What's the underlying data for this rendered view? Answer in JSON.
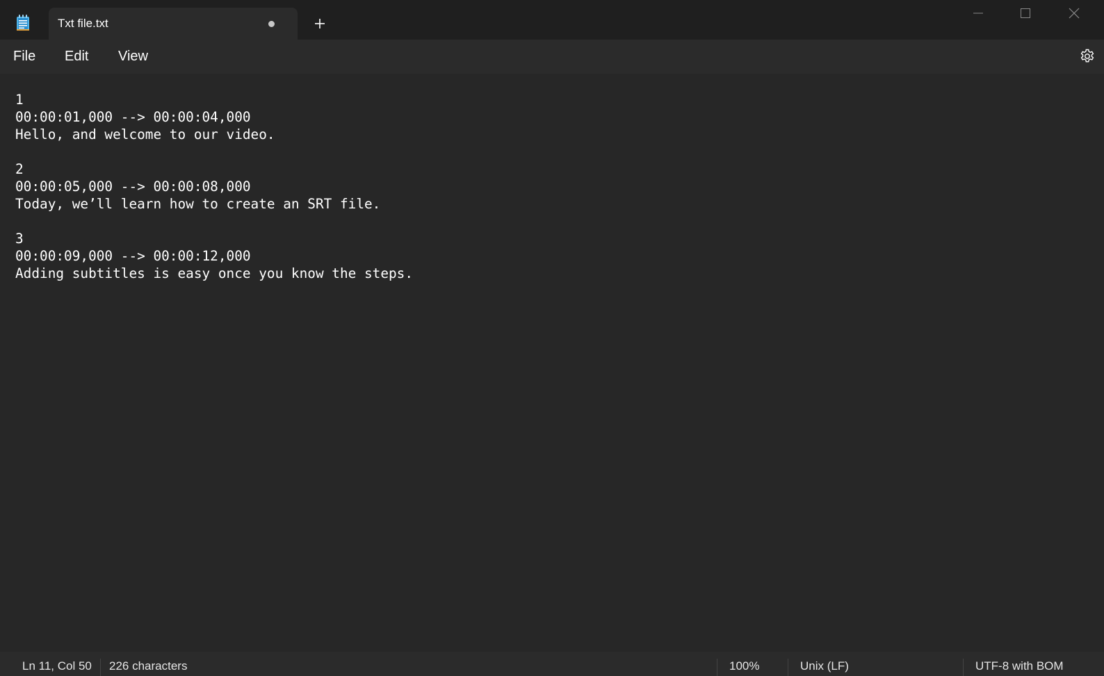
{
  "app": {
    "icon": "notepad-icon"
  },
  "tab": {
    "title": "Txt file.txt",
    "unsaved_indicator": "unsaved-dot-icon"
  },
  "titlebar": {
    "new_tab_icon": "plus-icon",
    "minimize_icon": "minimize-icon",
    "maximize_icon": "maximize-icon",
    "close_icon": "close-icon"
  },
  "menu": {
    "file": "File",
    "edit": "Edit",
    "view": "View",
    "settings_icon": "gear-icon"
  },
  "editor": {
    "content": "1\n00:00:01,000 --> 00:00:04,000\nHello, and welcome to our video.\n\n2\n00:00:05,000 --> 00:00:08,000\nToday, we’ll learn how to create an SRT file.\n\n3\n00:00:09,000 --> 00:00:12,000\nAdding subtitles is easy once you know the steps."
  },
  "status": {
    "position": "Ln 11, Col 50",
    "characters": "226 characters",
    "zoom": "100%",
    "line_ending": "Unix (LF)",
    "encoding": "UTF-8 with BOM"
  },
  "colors": {
    "titlebar_bg": "#1f1f1f",
    "tab_bg": "#2b2b2b",
    "editor_bg": "#272727",
    "text": "#ffffff"
  }
}
